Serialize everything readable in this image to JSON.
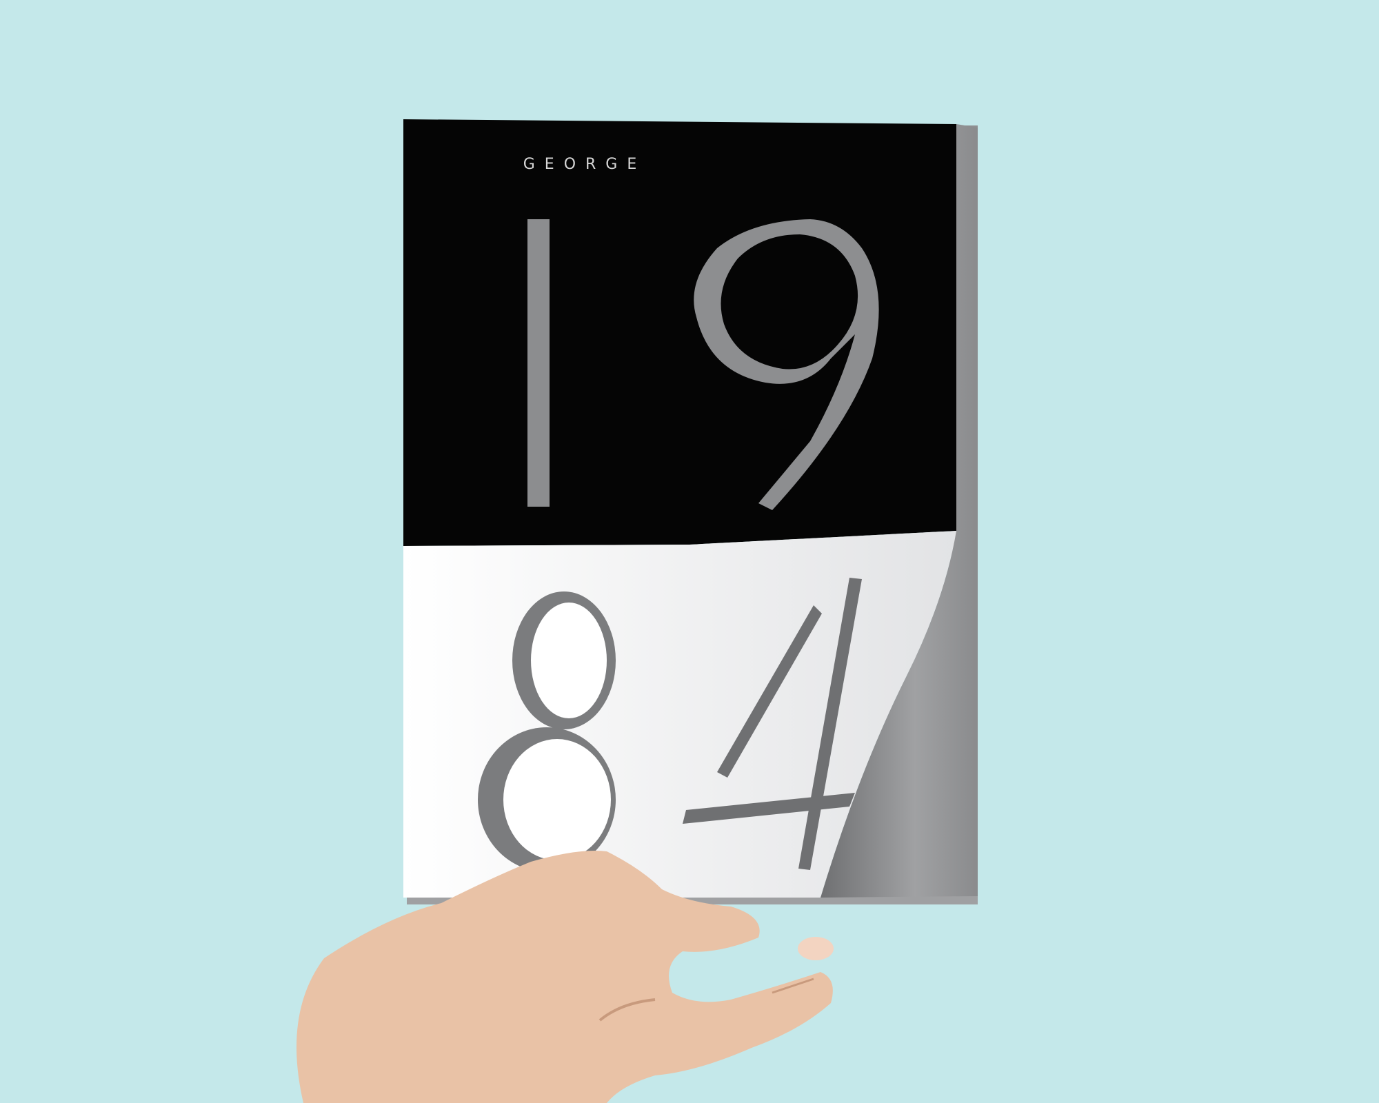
{
  "scene": {
    "cover_top_text": "GEORGE",
    "cover_numerals": [
      "1",
      "9",
      "8",
      "4"
    ],
    "colors": {
      "background": "#c4e8ea",
      "cover_black": "#050505",
      "cover_white": "#ffffff",
      "inner_page_gray": "#8f9092"
    },
    "icons": [
      "hand-icon"
    ]
  }
}
